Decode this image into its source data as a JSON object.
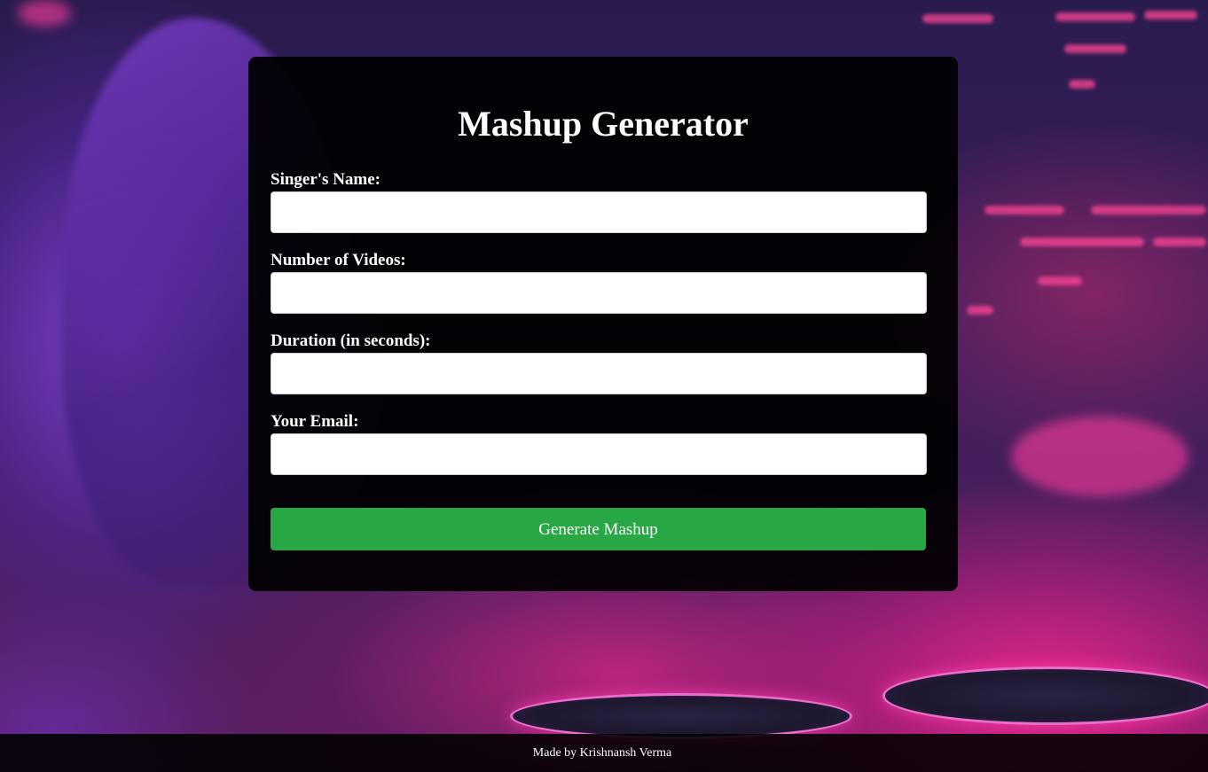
{
  "page": {
    "title": "Mashup Generator"
  },
  "form": {
    "fields": [
      {
        "label": "Singer's Name:",
        "value": "",
        "placeholder": ""
      },
      {
        "label": "Number of Videos:",
        "value": "",
        "placeholder": ""
      },
      {
        "label": "Duration (in seconds):",
        "value": "",
        "placeholder": ""
      },
      {
        "label": "Your Email:",
        "value": "",
        "placeholder": ""
      }
    ],
    "submit_label": "Generate Mashup"
  },
  "footer": {
    "text": "Made by Krishnansh Verma"
  },
  "colors": {
    "card_background": "#000000",
    "button_green": "#28a745",
    "text": "#ffffff",
    "neon_pink": "#ff2f96",
    "neon_purple": "#8a46dc"
  }
}
